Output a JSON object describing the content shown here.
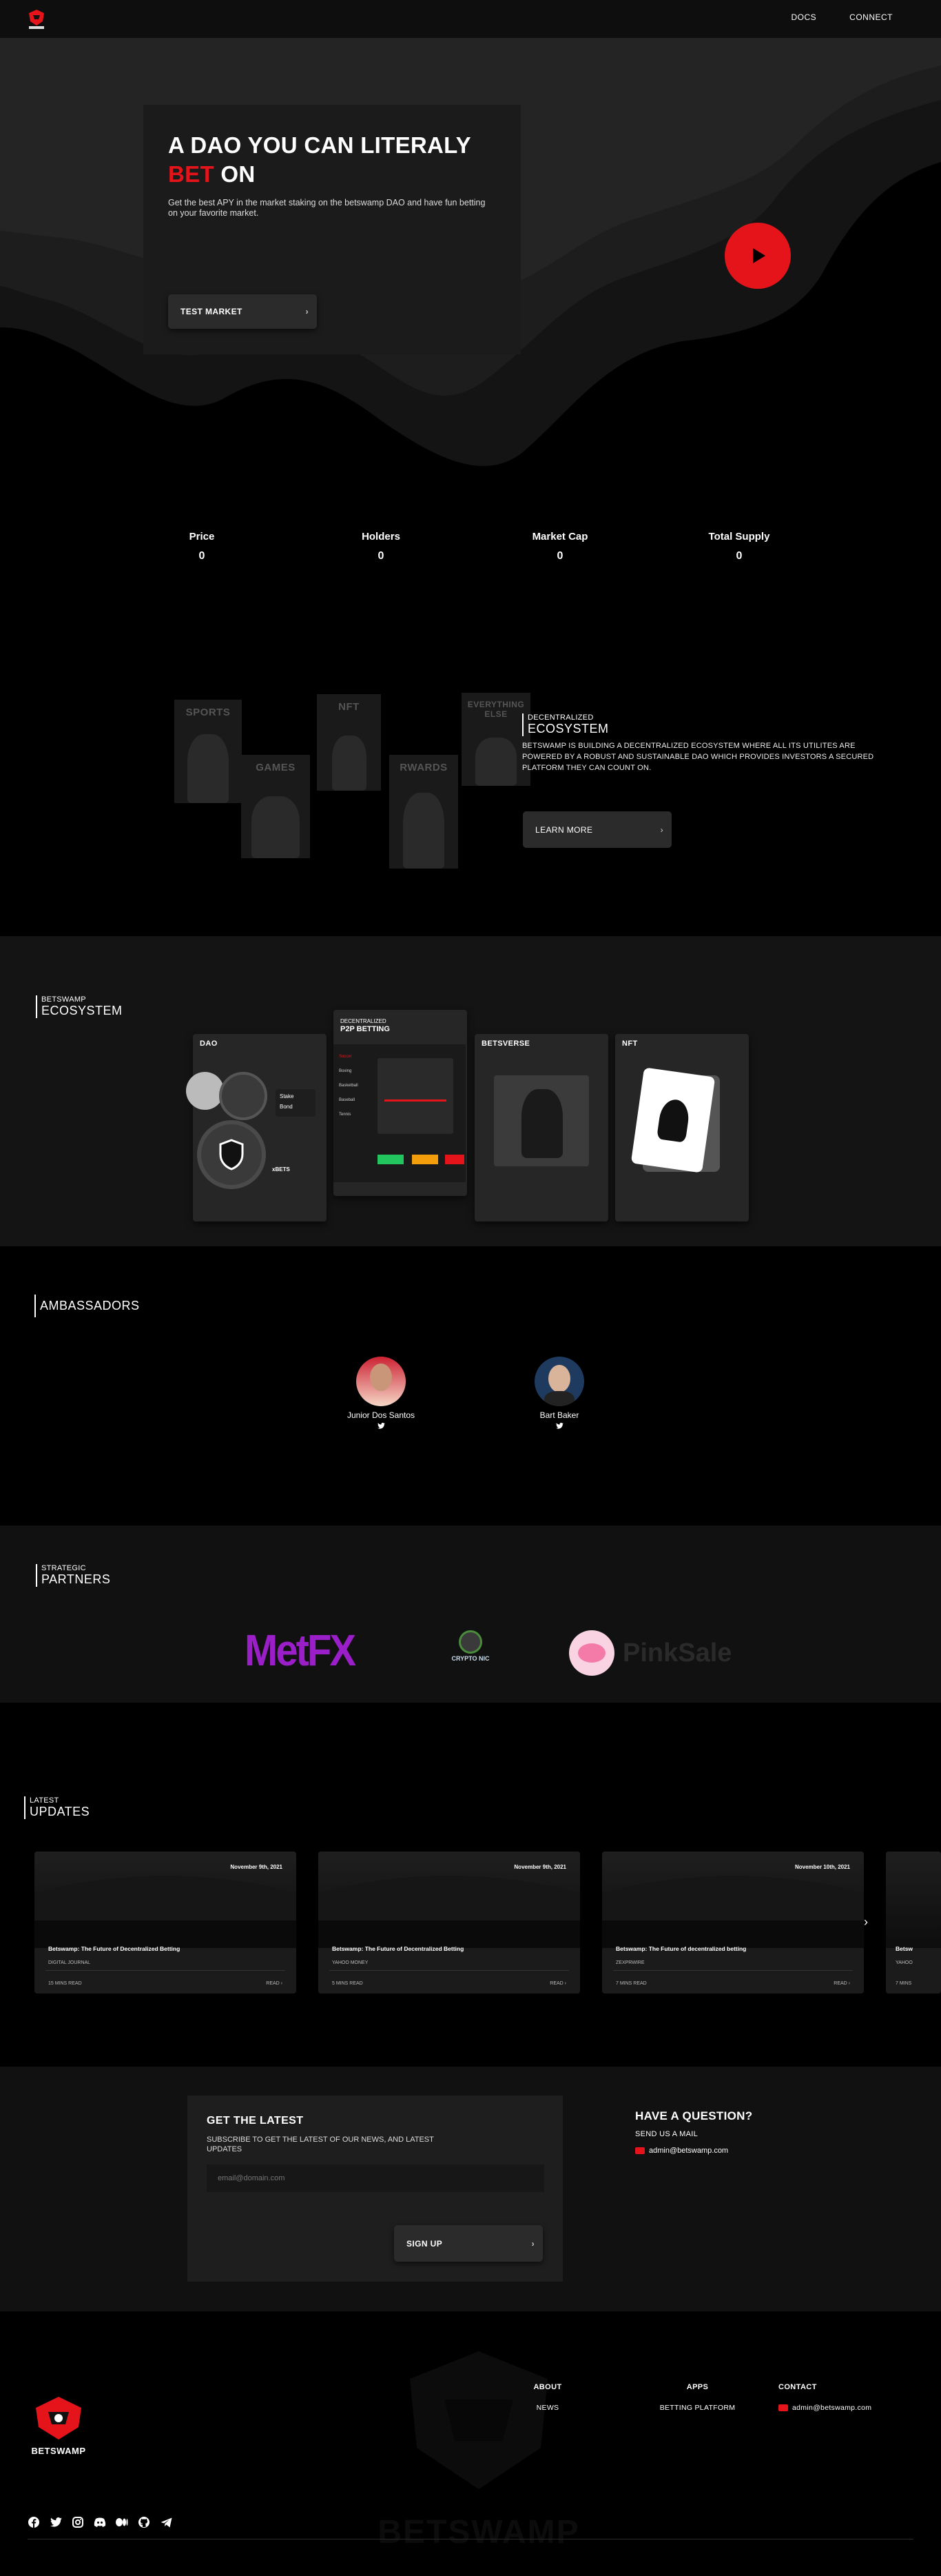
{
  "header": {
    "logo_alt": "Betswamp logo",
    "nav": [
      {
        "label": "DOCS"
      },
      {
        "label": "CONNECT"
      }
    ]
  },
  "hero": {
    "title_line1": "A DAO YOU CAN LITERALY",
    "title_red": "BET",
    "title_line2_rest": " ON",
    "subtitle": "Get the best APY in the market staking on the betswamp DAO and have fun betting on your favorite market.",
    "cta_label": "TEST MARKET",
    "play_icon": "play-icon"
  },
  "stats": [
    {
      "label": "Price",
      "value": "0"
    },
    {
      "label": "Holders",
      "value": "0"
    },
    {
      "label": "Market Cap",
      "value": "0"
    },
    {
      "label": "Total Supply",
      "value": "0"
    }
  ],
  "ecosystem_intro": {
    "tiles": [
      "SPORTS",
      "GAMES",
      "NFT",
      "RWARDS",
      "EVERYTHING ELSE"
    ],
    "eyebrow": "DECENTRALIZED",
    "heading": "ECOSYSTEM",
    "text": "BETSWAMP IS BUILDING A DECENTRALIZED ECOSYSTEM WHERE ALL ITS UTILITES ARE POWERED BY A ROBUST AND SUSTAINABLE DAO WHICH PROVIDES INVESTORS A SECURED PLATFORM THEY CAN COUNT ON.",
    "cta_label": "LEARN MORE"
  },
  "ecosystem_panels": {
    "eyebrow": "BETSWAMP",
    "heading": "ECOSYSTEM",
    "dao": {
      "title": "DAO",
      "stake_label": "Stake",
      "bond_label": "Bond",
      "token_label": "xBETS"
    },
    "p2p": {
      "eyebrow": "DECENTRALIZED",
      "title": "P2P BETTING",
      "sidebar": [
        "Soccer",
        "Boxing",
        "Basketball",
        "Baseball",
        "Tennis"
      ]
    },
    "betsverse": {
      "title": "BETSVERSE"
    },
    "nft": {
      "title": "NFT"
    }
  },
  "ambassadors": {
    "heading": "AMBASSADORS",
    "people": [
      {
        "name": "Junior Dos Santos"
      },
      {
        "name": "Bart Baker"
      }
    ]
  },
  "partners": {
    "eyebrow": "STRATEGIC",
    "heading": "PARTNERS",
    "logos": [
      "MetFX",
      "CRYPTO NIC",
      "PinkSale"
    ]
  },
  "updates": {
    "eyebrow": "LATEST",
    "heading": "UPDATES",
    "cards": [
      {
        "date": "November 9th, 2021",
        "title": "Betswamp: The Future of Decentralized Betting",
        "source": "DIGITAL JOURNAL",
        "read": "15 MINS READ",
        "more": "READ"
      },
      {
        "date": "November 9th, 2021",
        "title": "Betswamp: The Future of Decentralized Betting",
        "source": "YAHOO MONEY",
        "read": "5 MINS READ",
        "more": "READ"
      },
      {
        "date": "November 10th, 2021",
        "title": "Betswamp: The Future of decentralized betting",
        "source": "ZEXPRWIRE",
        "read": "7 MINS READ",
        "more": "READ"
      },
      {
        "date": "",
        "title": "Betsw",
        "source": "YAHOO",
        "read": "7 MINS",
        "more": ""
      }
    ]
  },
  "newsletter": {
    "title": "GET THE LATEST",
    "subtitle": "SUBSCRIBE TO GET THE LATEST OF OUR NEWS, AND LATEST UPDATES",
    "placeholder": "email@domain.com",
    "button": "SIGN UP",
    "question_title": "HAVE A QUESTION?",
    "question_sub": "SEND US A MAIL",
    "email": "admin@betswamp.com"
  },
  "footer": {
    "columns": [
      {
        "heading": "ABOUT",
        "item": "NEWS"
      },
      {
        "heading": "APPS",
        "item": "BETTING PLATFORM"
      },
      {
        "heading": "CONTACT",
        "item": "admin@betswamp.com"
      }
    ],
    "watermark": "BETSWAMP",
    "logo_text": "BETSWAMP",
    "socials": [
      "facebook-icon",
      "twitter-icon",
      "instagram-icon",
      "discord-icon",
      "medium-icon",
      "github-icon",
      "telegram-icon"
    ]
  },
  "colors": {
    "accent": "#e5141b",
    "bg": "#000000",
    "panel": "#141414",
    "card": "#1b1b1b"
  }
}
